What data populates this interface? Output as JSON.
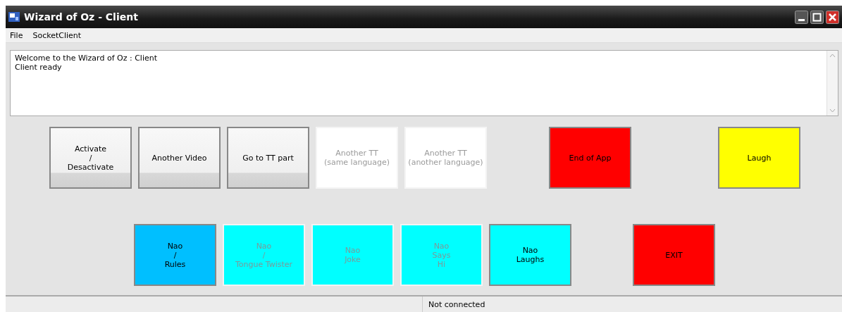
{
  "window": {
    "title": "Wizard of Oz - Client"
  },
  "menu": [
    "File",
    "SocketClient"
  ],
  "log": {
    "lines": [
      "Welcome to the Wizard of Oz : Client",
      "Client ready"
    ]
  },
  "button_rows": [
    [
      {
        "lines": [
          "Activate",
          "/",
          "Desactivate"
        ],
        "kind": "plain",
        "disabled": false
      },
      {
        "lines": [
          "Another Video"
        ],
        "kind": "plain",
        "disabled": false
      },
      {
        "lines": [
          "Go to TT part"
        ],
        "kind": "plain",
        "disabled": false
      },
      {
        "lines": [
          "Another TT",
          "(same language)"
        ],
        "kind": "plain",
        "disabled": true
      },
      {
        "lines": [
          "Another TT",
          "(another language)"
        ],
        "kind": "plain",
        "disabled": true
      },
      {
        "lines": [
          "End of App"
        ],
        "kind": "colored",
        "color": "#ff0000",
        "disabled": false
      },
      {
        "lines": [
          "Laugh"
        ],
        "kind": "colored",
        "color": "#ffff00",
        "disabled": false
      }
    ],
    [
      {
        "lines": [
          "Nao",
          "/",
          "Rules"
        ],
        "kind": "colored",
        "color": "#00bfff",
        "disabled": false
      },
      {
        "lines": [
          "Nao",
          "/",
          "Tongue Twister"
        ],
        "kind": "colored",
        "color": "#00ffff",
        "disabled": true
      },
      {
        "lines": [
          "Nao",
          "Joke"
        ],
        "kind": "colored",
        "color": "#00ffff",
        "disabled": true
      },
      {
        "lines": [
          "Nao",
          "Says",
          "Hi"
        ],
        "kind": "colored",
        "color": "#00ffff",
        "disabled": true
      },
      {
        "lines": [
          "Nao",
          "Laughs"
        ],
        "kind": "colored",
        "color": "#00ffff",
        "disabled": false
      },
      {
        "lines": [
          "EXIT"
        ],
        "kind": "colored",
        "color": "#ff0000",
        "disabled": false
      }
    ]
  ],
  "status_bar": {
    "text": "Not connected"
  }
}
